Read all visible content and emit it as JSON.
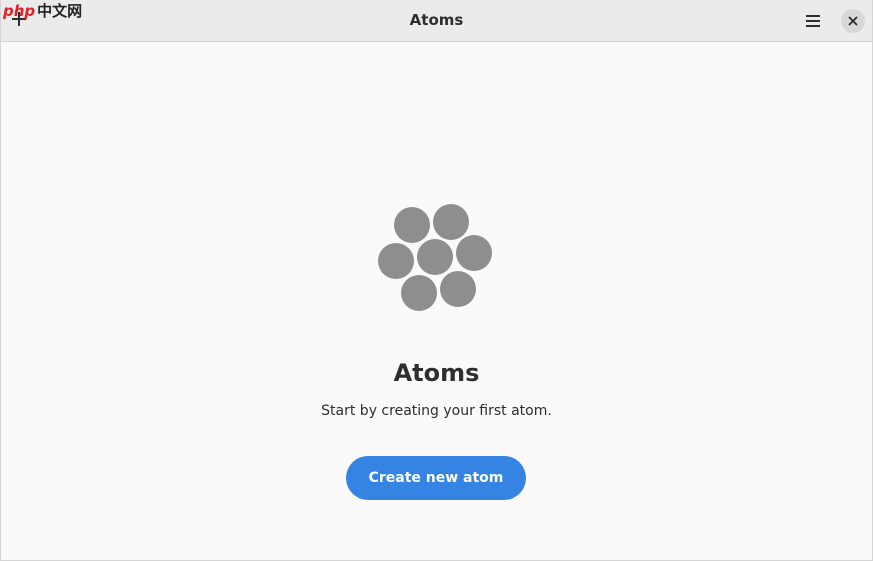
{
  "window": {
    "title": "Atoms"
  },
  "header": {
    "add_icon": "plus-icon",
    "menu_icon": "hamburger-menu-icon",
    "close_icon": "close-icon",
    "watermark_latin": "php",
    "watermark_cn": "中文网"
  },
  "empty_state": {
    "icon": "atoms-cluster-icon",
    "title": "Atoms",
    "description": "Start by creating your first atom.",
    "button_label": "Create new atom"
  },
  "colors": {
    "accent": "#3584e4",
    "header_bg": "#ebebeb",
    "content_bg": "#fafafa",
    "icon_gray": "#8e8e8e",
    "text": "#2e2e2e"
  }
}
